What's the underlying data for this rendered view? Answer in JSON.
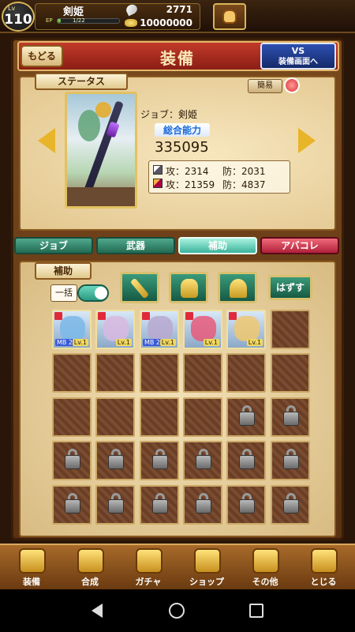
{
  "top_bar": {
    "level_prefix": "Lv",
    "level": "110",
    "player_name": "剣姫",
    "ep_label": "EP",
    "ep_value": "1/22",
    "ep_fraction": 0.05,
    "gem_count": "2771",
    "gold_count": "10000000"
  },
  "header": {
    "back_label": "もどる",
    "title": "装備",
    "vs_line1": "VS",
    "vs_line2": "装備画面へ"
  },
  "status": {
    "tag": "ステータス",
    "simple_label": "簡易",
    "job": "ジョブ：剣姫",
    "power_label": "総合能力",
    "power_value": "335095",
    "stat_row1_atk": "攻：2314",
    "stat_row1_def": "防：2031",
    "stat_row2_atk": "攻：21359",
    "stat_row2_def": "防：4837"
  },
  "tabs": [
    {
      "label": "ジョブ",
      "state": "normal"
    },
    {
      "label": "武器",
      "state": "normal"
    },
    {
      "label": "補助",
      "state": "active"
    },
    {
      "label": "アバコレ",
      "state": "red"
    }
  ],
  "equip": {
    "tag": "補助",
    "bulk_label": "一括",
    "bulk_toggle_on": true,
    "unequip_label": "はずす",
    "slot_icons": [
      "sword-icon",
      "armor-icon",
      "helmet-icon"
    ],
    "items": [
      {
        "color": "#7ab8e8",
        "mb": "MB 2",
        "lv": "Lv.1"
      },
      {
        "color": "#d8b8e0",
        "mb": "",
        "lv": "Lv.1"
      },
      {
        "color": "#b8a8d0",
        "mb": "MB 2",
        "lv": "Lv.1"
      },
      {
        "color": "#e85a7a",
        "mb": "",
        "lv": "Lv.1"
      },
      {
        "color": "#f0c870",
        "mb": "",
        "lv": "Lv.1"
      }
    ]
  },
  "bottom_nav": [
    {
      "label": "装備",
      "icon": "equipment-icon"
    },
    {
      "label": "合成",
      "icon": "hammer-icon"
    },
    {
      "label": "ガチャ",
      "icon": "gacha-icon"
    },
    {
      "label": "ショップ",
      "icon": "shop-crystal-icon"
    },
    {
      "label": "その他",
      "icon": "gear-icon"
    },
    {
      "label": "とじる",
      "icon": "close-icon"
    }
  ]
}
